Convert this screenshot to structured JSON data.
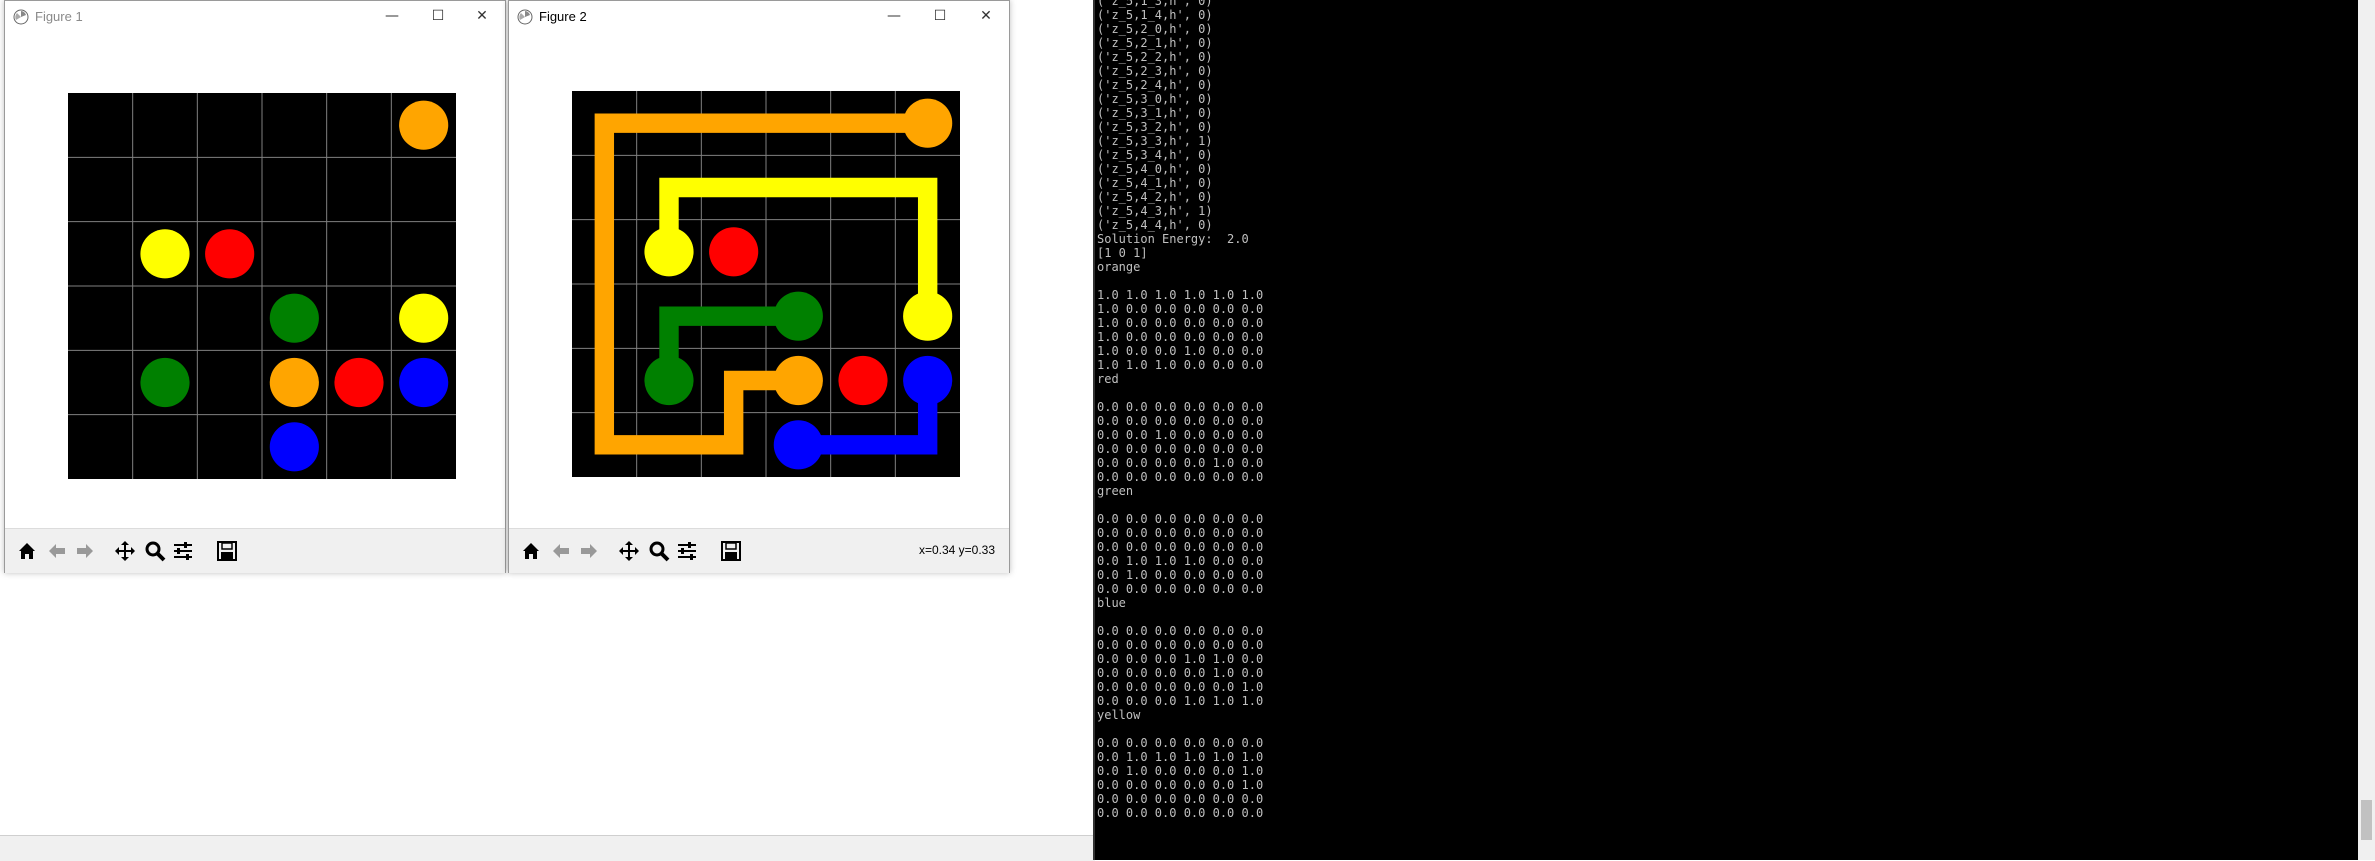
{
  "colors": {
    "orange": "#ffa500",
    "red": "#ff0000",
    "yellow": "#ffff00",
    "green": "#008000",
    "blue": "#0000ff",
    "board_bg": "#000000",
    "grid": "#808080"
  },
  "figure1": {
    "title": "Figure 1",
    "grid_size": 6,
    "dots": [
      {
        "row": 0,
        "col": 5,
        "color": "orange"
      },
      {
        "row": 2,
        "col": 1,
        "color": "yellow"
      },
      {
        "row": 2,
        "col": 2,
        "color": "red"
      },
      {
        "row": 3,
        "col": 3,
        "color": "green"
      },
      {
        "row": 3,
        "col": 5,
        "color": "yellow"
      },
      {
        "row": 4,
        "col": 1,
        "color": "green"
      },
      {
        "row": 4,
        "col": 3,
        "color": "orange"
      },
      {
        "row": 4,
        "col": 4,
        "color": "red"
      },
      {
        "row": 4,
        "col": 5,
        "color": "blue"
      },
      {
        "row": 5,
        "col": 3,
        "color": "blue"
      }
    ],
    "toolbar": [
      "home-icon",
      "back-arrow-icon",
      "forward-arrow-icon",
      "pan-icon",
      "zoom-icon",
      "configure-subplots-icon",
      "save-icon"
    ]
  },
  "figure2": {
    "title": "Figure 2",
    "grid_size": 6,
    "coords": "x=0.34 y=0.33",
    "paths": [
      {
        "color": "orange",
        "points": [
          [
            0,
            5
          ],
          [
            0,
            0
          ],
          [
            5,
            0
          ],
          [
            5,
            2
          ],
          [
            4,
            2
          ],
          [
            4,
            3
          ]
        ]
      },
      {
        "color": "yellow",
        "points": [
          [
            2,
            1
          ],
          [
            1,
            1
          ],
          [
            1,
            5
          ],
          [
            3,
            5
          ]
        ]
      },
      {
        "color": "green",
        "points": [
          [
            4,
            1
          ],
          [
            3,
            1
          ],
          [
            3,
            3
          ]
        ]
      },
      {
        "color": "blue",
        "points": [
          [
            4,
            5
          ],
          [
            5,
            5
          ],
          [
            5,
            3
          ]
        ]
      }
    ],
    "dots": [
      {
        "row": 0,
        "col": 5,
        "color": "orange"
      },
      {
        "row": 2,
        "col": 1,
        "color": "yellow"
      },
      {
        "row": 2,
        "col": 2,
        "color": "red"
      },
      {
        "row": 3,
        "col": 3,
        "color": "green"
      },
      {
        "row": 3,
        "col": 5,
        "color": "yellow"
      },
      {
        "row": 4,
        "col": 1,
        "color": "green"
      },
      {
        "row": 4,
        "col": 3,
        "color": "orange"
      },
      {
        "row": 4,
        "col": 4,
        "color": "red"
      },
      {
        "row": 4,
        "col": 5,
        "color": "blue"
      },
      {
        "row": 5,
        "col": 3,
        "color": "blue"
      }
    ]
  },
  "console": {
    "lines": [
      "('z_5,1_3,h', 0)",
      "('z_5,1_4,h', 0)",
      "('z_5,2_0,h', 0)",
      "('z_5,2_1,h', 0)",
      "('z_5,2_2,h', 0)",
      "('z_5,2_3,h', 0)",
      "('z_5,2_4,h', 0)",
      "('z_5,3_0,h', 0)",
      "('z_5,3_1,h', 0)",
      "('z_5,3_2,h', 0)",
      "('z_5,3_3,h', 1)",
      "('z_5,3_4,h', 0)",
      "('z_5,4_0,h', 0)",
      "('z_5,4_1,h', 0)",
      "('z_5,4_2,h', 0)",
      "('z_5,4_3,h', 1)",
      "('z_5,4_4,h', 0)",
      "Solution Energy:  2.0",
      "[1 0 1]",
      "orange",
      "",
      "1.0 1.0 1.0 1.0 1.0 1.0",
      "1.0 0.0 0.0 0.0 0.0 0.0",
      "1.0 0.0 0.0 0.0 0.0 0.0",
      "1.0 0.0 0.0 0.0 0.0 0.0",
      "1.0 0.0 0.0 1.0 0.0 0.0",
      "1.0 1.0 1.0 0.0 0.0 0.0",
      "red",
      "",
      "0.0 0.0 0.0 0.0 0.0 0.0",
      "0.0 0.0 0.0 0.0 0.0 0.0",
      "0.0 0.0 1.0 0.0 0.0 0.0",
      "0.0 0.0 0.0 0.0 0.0 0.0",
      "0.0 0.0 0.0 0.0 1.0 0.0",
      "0.0 0.0 0.0 0.0 0.0 0.0",
      "green",
      "",
      "0.0 0.0 0.0 0.0 0.0 0.0",
      "0.0 0.0 0.0 0.0 0.0 0.0",
      "0.0 0.0 0.0 0.0 0.0 0.0",
      "0.0 1.0 1.0 1.0 0.0 0.0",
      "0.0 1.0 0.0 0.0 0.0 0.0",
      "0.0 0.0 0.0 0.0 0.0 0.0",
      "blue",
      "",
      "0.0 0.0 0.0 0.0 0.0 0.0",
      "0.0 0.0 0.0 0.0 0.0 0.0",
      "0.0 0.0 0.0 1.0 1.0 0.0",
      "0.0 0.0 0.0 0.0 1.0 0.0",
      "0.0 0.0 0.0 0.0 0.0 1.0",
      "0.0 0.0 0.0 1.0 1.0 1.0",
      "yellow",
      "",
      "0.0 0.0 0.0 0.0 0.0 0.0",
      "0.0 1.0 1.0 1.0 1.0 1.0",
      "0.0 1.0 0.0 0.0 0.0 1.0",
      "0.0 0.0 0.0 0.0 0.0 1.0",
      "0.0 0.0 0.0 0.0 0.0 0.0",
      "0.0 0.0 0.0 0.0 0.0 0.0"
    ]
  }
}
